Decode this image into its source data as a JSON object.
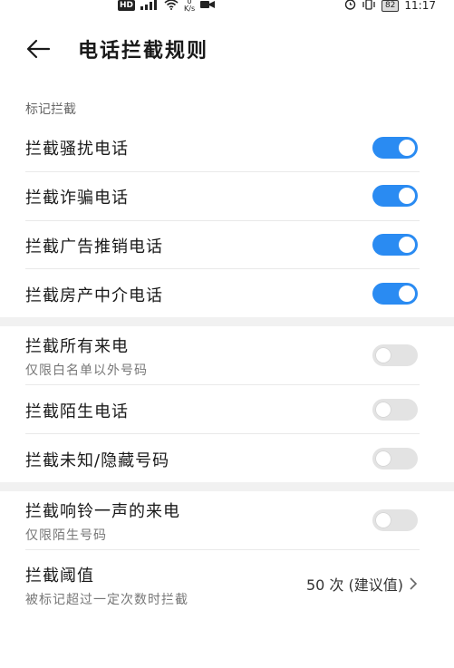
{
  "status_bar": {
    "hd": "HD",
    "net_speed_value": "0",
    "net_speed_unit": "K/s",
    "battery": "82",
    "time": "11:17"
  },
  "header": {
    "title": "电话拦截规则"
  },
  "section_marked": {
    "label": "标记拦截",
    "items": [
      {
        "label": "拦截骚扰电话",
        "on": true
      },
      {
        "label": "拦截诈骗电话",
        "on": true
      },
      {
        "label": "拦截广告推销电话",
        "on": true
      },
      {
        "label": "拦截房产中介电话",
        "on": true
      }
    ]
  },
  "section_calls": {
    "all_calls": {
      "label": "拦截所有来电",
      "sub": "仅限白名单以外号码",
      "on": false
    },
    "strangers": {
      "label": "拦截陌生电话",
      "on": false
    },
    "unknown": {
      "label": "拦截未知/隐藏号码",
      "on": false
    }
  },
  "section_ring": {
    "ring_once": {
      "label": "拦截响铃一声的来电",
      "sub": "仅限陌生号码",
      "on": false
    },
    "threshold": {
      "label": "拦截阈值",
      "sub": "被标记超过一定次数时拦截",
      "value": "50 次 (建议值)"
    }
  },
  "colors": {
    "toggle_on": "#2a8bf2",
    "toggle_off": "#e3e3e3"
  }
}
